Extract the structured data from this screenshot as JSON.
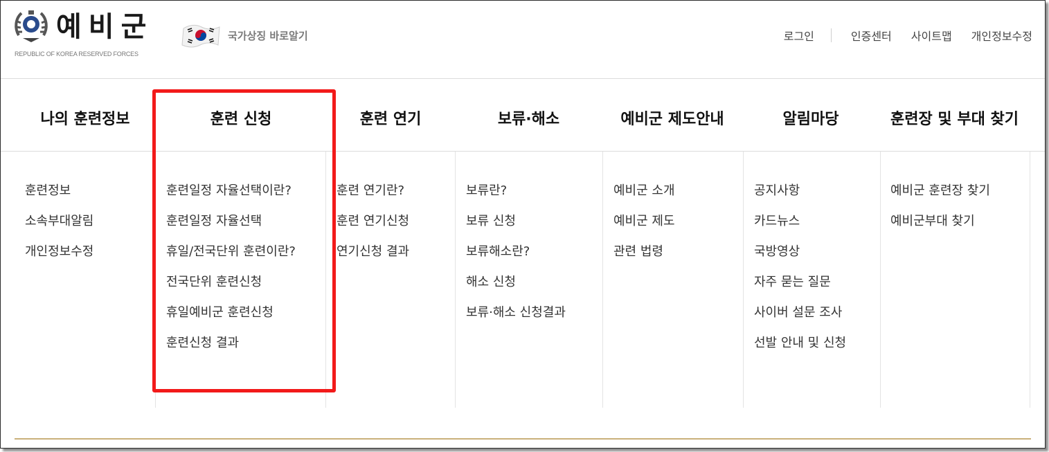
{
  "brand": {
    "name": "예비군",
    "subtitle": "REPUBLIC OF KOREA RESERVED FORCES",
    "emblem_icon": "reserve-forces-emblem-icon",
    "symbol_link": "국가상징 바로알기",
    "symbol_icon": "korean-flag-icon"
  },
  "util_nav": [
    "로그인",
    "인증센터",
    "사이트맵",
    "개인정보수정"
  ],
  "main_nav": [
    "나의 훈련정보",
    "훈련 신청",
    "훈련 연기",
    "보류·해소",
    "예비군 제도안내",
    "알림마당",
    "훈련장 및 부대 찾기"
  ],
  "submenus": [
    [
      "훈련정보",
      "소속부대알림",
      "개인정보수정"
    ],
    [
      "훈련일정 자율선택이란?",
      "훈련일정 자율선택",
      "휴일/전국단위 훈련이란?",
      "전국단위 훈련신청",
      "휴일예비군 훈련신청",
      "훈련신청 결과"
    ],
    [
      "훈련 연기란?",
      "훈련 연기신청",
      "연기신청 결과"
    ],
    [
      "보류란?",
      "보류 신청",
      "보류해소란?",
      "해소 신청",
      "보류·해소 신청결과"
    ],
    [
      "예비군 소개",
      "예비군 제도",
      "관련 법령"
    ],
    [
      "공지사항",
      "카드뉴스",
      "국방영상",
      "자주 묻는 질문",
      "사이버 설문 조사",
      "선발 안내 및 신청"
    ],
    [
      "예비군 훈련장 찾기",
      "예비군부대 찾기"
    ]
  ],
  "colors": {
    "highlight": "#f21a1a",
    "menu_bottom_border": "#c9b07a"
  }
}
